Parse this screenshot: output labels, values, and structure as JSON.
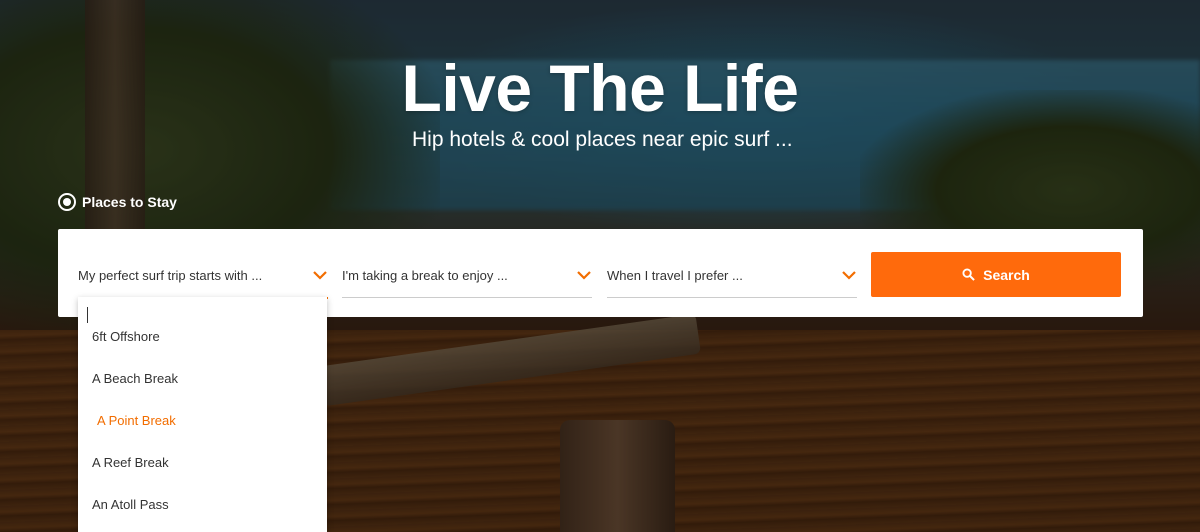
{
  "hero": {
    "title": "Live The Life",
    "subtitle": "Hip hotels & cool places near epic surf ..."
  },
  "search_type": {
    "label": "Places to Stay",
    "selected": true
  },
  "search": {
    "fields": [
      {
        "placeholder": "My perfect surf trip starts with ...",
        "active": true
      },
      {
        "placeholder": "I'm taking a break to enjoy ...",
        "active": false
      },
      {
        "placeholder": "When I travel I prefer ...",
        "active": false
      }
    ],
    "button_label": "Search",
    "button_icon": "search-icon"
  },
  "dropdown": {
    "options": [
      "6ft Offshore",
      "A Beach Break",
      "A Point Break",
      "A Reef Break",
      "An Atoll Pass"
    ],
    "highlighted": "A Point Break"
  },
  "colors": {
    "accent": "#ff6a0c",
    "highlight_text": "#f26d00"
  }
}
